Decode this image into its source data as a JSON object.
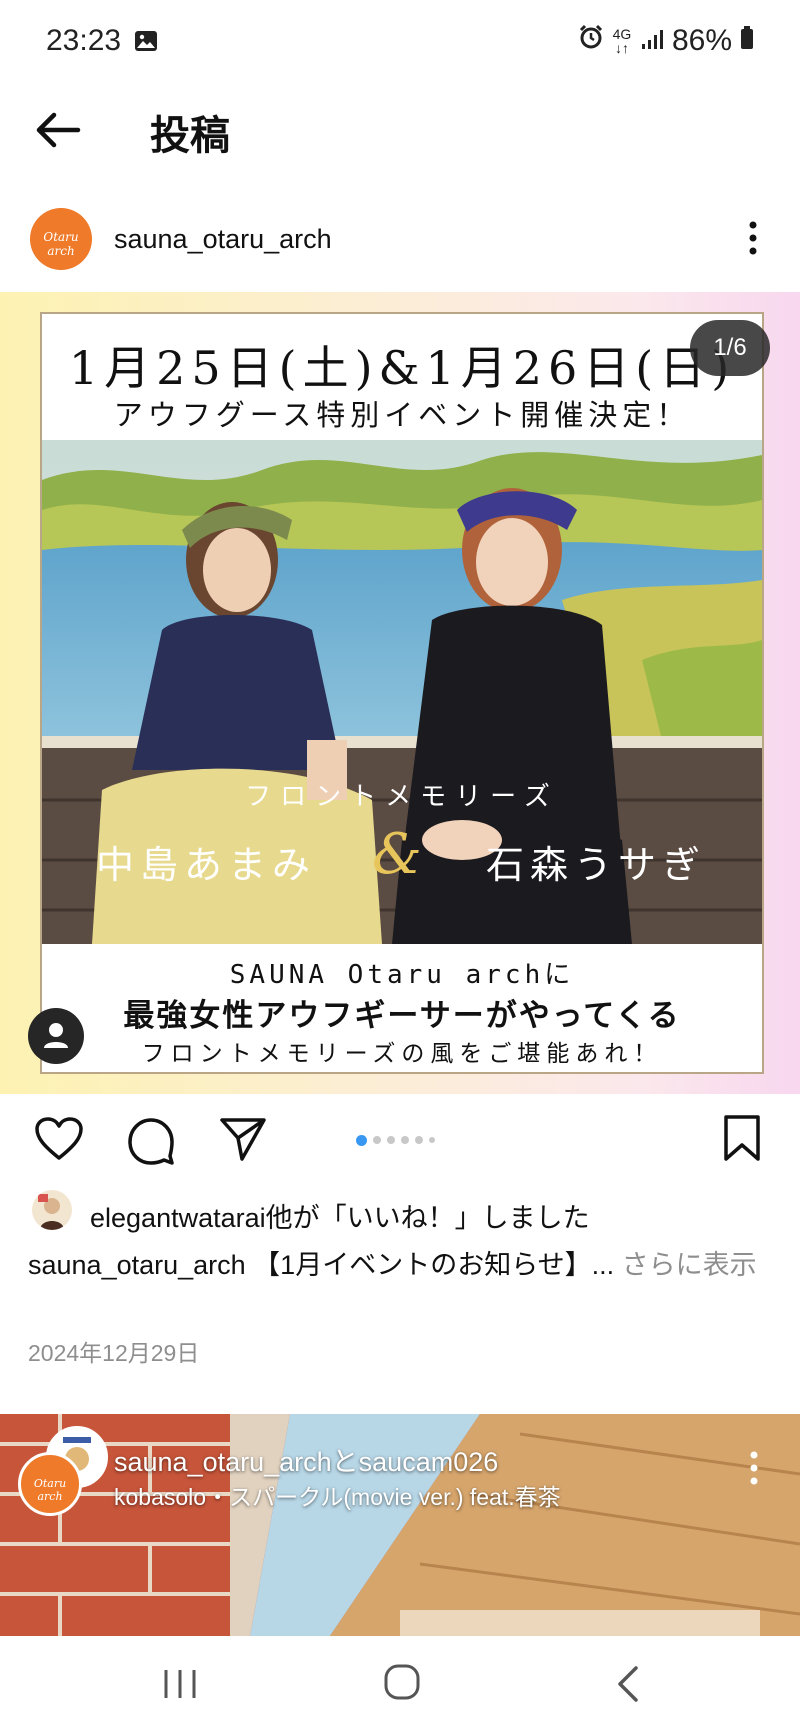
{
  "status_bar": {
    "time": "23:23",
    "network": "4G",
    "battery": "86%",
    "icons": [
      "photo-icon",
      "alarm-icon",
      "signal-icon",
      "battery-icon"
    ]
  },
  "header": {
    "title": "投稿",
    "back_icon": "arrow-left-icon"
  },
  "post": {
    "username": "sauna_otaru_arch",
    "avatar_text": "Otaru arch",
    "image_counter": "1/6",
    "poster": {
      "date_line": "1月25日(土)&1月26日(日)",
      "subtitle": "アウフグース特別イベント開催決定！",
      "group": "フロントメモリーズ",
      "name_left": "中島あまみ",
      "ampersand": "&",
      "name_right": "石森うサぎ",
      "line1": "SAUNA  Otaru  archに",
      "line2": "最強女性アウフギーサーがやってくる",
      "line3": "フロントメモリーズの風をご堪能あれ！"
    },
    "carousel": {
      "total": 6,
      "active": 1
    },
    "likes_user": "elegantwatarai",
    "likes_suffix": "他が「いいね！」しました",
    "caption_user": "sauna_otaru_arch",
    "caption_text": " 【1月イベントのお知らせ】...",
    "caption_more": " さらに表示",
    "date": "2024年12月29日"
  },
  "next_post": {
    "users": "sauna_otaru_archとsaucam026",
    "music": "kobasolo・スパークル(movie ver.) feat.春茶"
  },
  "colors": {
    "accent_blue": "#3897f0",
    "avatar_orange": "#ee7a2a",
    "muted_gray": "#8e8e8e"
  }
}
